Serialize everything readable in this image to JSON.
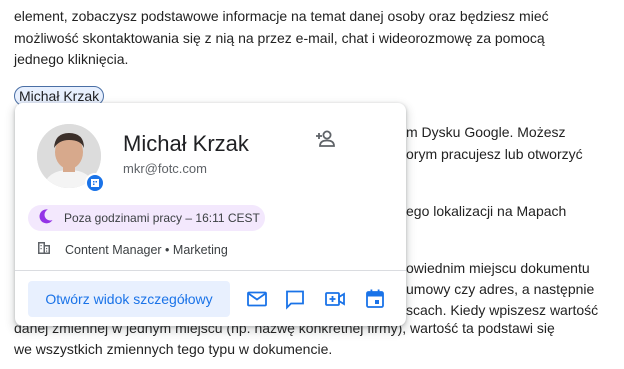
{
  "document": {
    "lines": [
      "element, zobaczysz podstawowe informacje na temat danej osoby oraz będziesz mieć",
      "możliwość skontaktowania się z nią na przez e-mail, chat i wideorozmowę za pomocą",
      "jednego kliknięcia."
    ],
    "right_fragments": [
      "m Dysku Google. Możesz",
      "orym pracujesz lub otworzyć",
      "ego lokalizacji na Mapach",
      "owiednim miejscu dokumentu",
      "umowy czy adres, a następnie",
      "scach. Kiedy wpiszesz wartość"
    ],
    "bottom_lines": [
      "danej zmiennej w jednym miejscu (np. nazwę konkretnej firmy), wartość ta podstawi się",
      "we wszystkich zmiennych tego typu w dokumencie."
    ]
  },
  "chip": {
    "label": "Michał Krzak"
  },
  "card": {
    "name": "Michał Krzak",
    "email": "mkr@fotc.com",
    "status": "Poza godzinami pracy – 16:11 CEST",
    "role": "Content Manager • Marketing",
    "details_button": "Otwórz widok szczegółowy",
    "icons": {
      "add": "add-person-icon",
      "badge": "building-icon",
      "status": "moon-icon",
      "role": "building-icon",
      "mail": "mail-icon",
      "chat": "chat-icon",
      "video": "video-call-icon",
      "calendar": "calendar-icon"
    },
    "colors": {
      "accent": "#1a73e8",
      "status_bg": "#f3e8fd",
      "moon": "#9334e6"
    }
  }
}
